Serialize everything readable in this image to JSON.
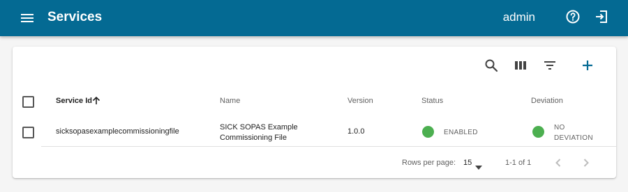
{
  "colors": {
    "appbar": "#046a93",
    "accent": "#046a93",
    "status_ok": "#4caf50"
  },
  "appbar": {
    "title": "Services",
    "user": "admin",
    "icons": [
      "menu-icon",
      "help-circle-icon",
      "logout-icon"
    ]
  },
  "toolbar": {
    "icons": [
      "search-icon",
      "view-columns-icon",
      "filter-icon",
      "add-icon"
    ]
  },
  "table": {
    "columns": [
      "Service Id",
      "Name",
      "Version",
      "Status",
      "Deviation"
    ],
    "sort": {
      "column": "Service Id",
      "direction": "ascending"
    },
    "rows": [
      {
        "service_id": "sicksopasexamplecommissioningfile",
        "name_line1": "SICK SOPAS Example",
        "name_line2": "Commissioning File",
        "version": "1.0.0",
        "status": "ENABLED",
        "deviation_line1": "NO",
        "deviation_line2": "DEVIATION"
      }
    ]
  },
  "pagination": {
    "rows_per_page_label": "Rows per page:",
    "rows_per_page_value": "15",
    "range": "1-1 of 1"
  }
}
